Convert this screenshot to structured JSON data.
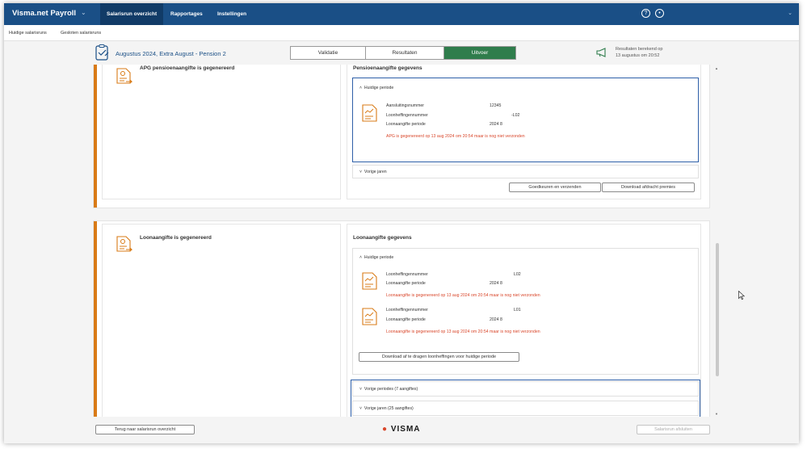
{
  "app": {
    "name": "Visma.net Payroll"
  },
  "nav": [
    {
      "label": "Salarisrun overzicht",
      "active": true
    },
    {
      "label": "Rapportages",
      "active": false
    },
    {
      "label": "Instellingen",
      "active": false
    }
  ],
  "top_icons": [
    "help-icon",
    "accessibility-icon"
  ],
  "breadcrumb": [
    "Huidige salarisruns",
    "Gesloten salarisruns"
  ],
  "run": {
    "title": "Augustus 2024, Extra August - Pension 2",
    "tabs": [
      "Validatie",
      "Resultaten",
      "Uitvoer"
    ],
    "active_tab": "Uitvoer",
    "calc_line1": "Resultaten berekend op",
    "calc_line2": "13 augustus om 20:52"
  },
  "apg": {
    "title": "APG pensioenaangifte is gegenereerd",
    "panel_title": "Pensioenaangifte gegevens",
    "current_head": "Huidige periode",
    "rows": [
      {
        "label": "Aansluitingsnummer",
        "value": "12345"
      },
      {
        "label": "Loonheffingennummer",
        "value": "-L02"
      },
      {
        "label": "Loonaangifte periode",
        "value": "2024 8"
      }
    ],
    "warning": "APG is gegenereerd op 13 aug 2024 om 20:54 maar is nog niet verzonden",
    "previous_head": "Vorige jaren",
    "btn_approve": "Goedkeuren en verzenden",
    "btn_download": "Download afdracht premies"
  },
  "loon": {
    "title": "Loonaangifte is gegenereerd",
    "panel_title": "Loonaangifte gegevens",
    "current_head": "Huidige periode",
    "entries": [
      {
        "rows": [
          {
            "label": "Loonheffingennummer",
            "value": "L02"
          },
          {
            "label": "Loonaangifte periode",
            "value": "2024 8"
          }
        ],
        "warning": "Loonaangifte is gegenereerd op 13 aug 2024 om 20:54 maar is nog niet verzonden"
      },
      {
        "rows": [
          {
            "label": "Loonheffingennummer",
            "value": "L01"
          },
          {
            "label": "Loonaangifte periode",
            "value": "2024 8"
          }
        ],
        "warning": "Loonaangifte is gegenereerd op 13 aug 2024 om 20:54 maar is nog niet verzonden"
      }
    ],
    "btn_download": "Download af te dragen loonheffingen voor huidige periode",
    "previous_periods": "Vorige periodes (7 aangiftes)",
    "previous_years": "Vorige jaren (25 aangiftes)"
  },
  "footer": {
    "back": "Terug naar salarisrun overzicht",
    "logo": "VISMA",
    "close": "Salarisrun afsluiten"
  },
  "colors": {
    "brand": "#1a4f86",
    "active_tab": "#2f7d4c",
    "accent": "#d97b17",
    "warning": "#d9472b",
    "highlight": "#2e5fa8"
  }
}
